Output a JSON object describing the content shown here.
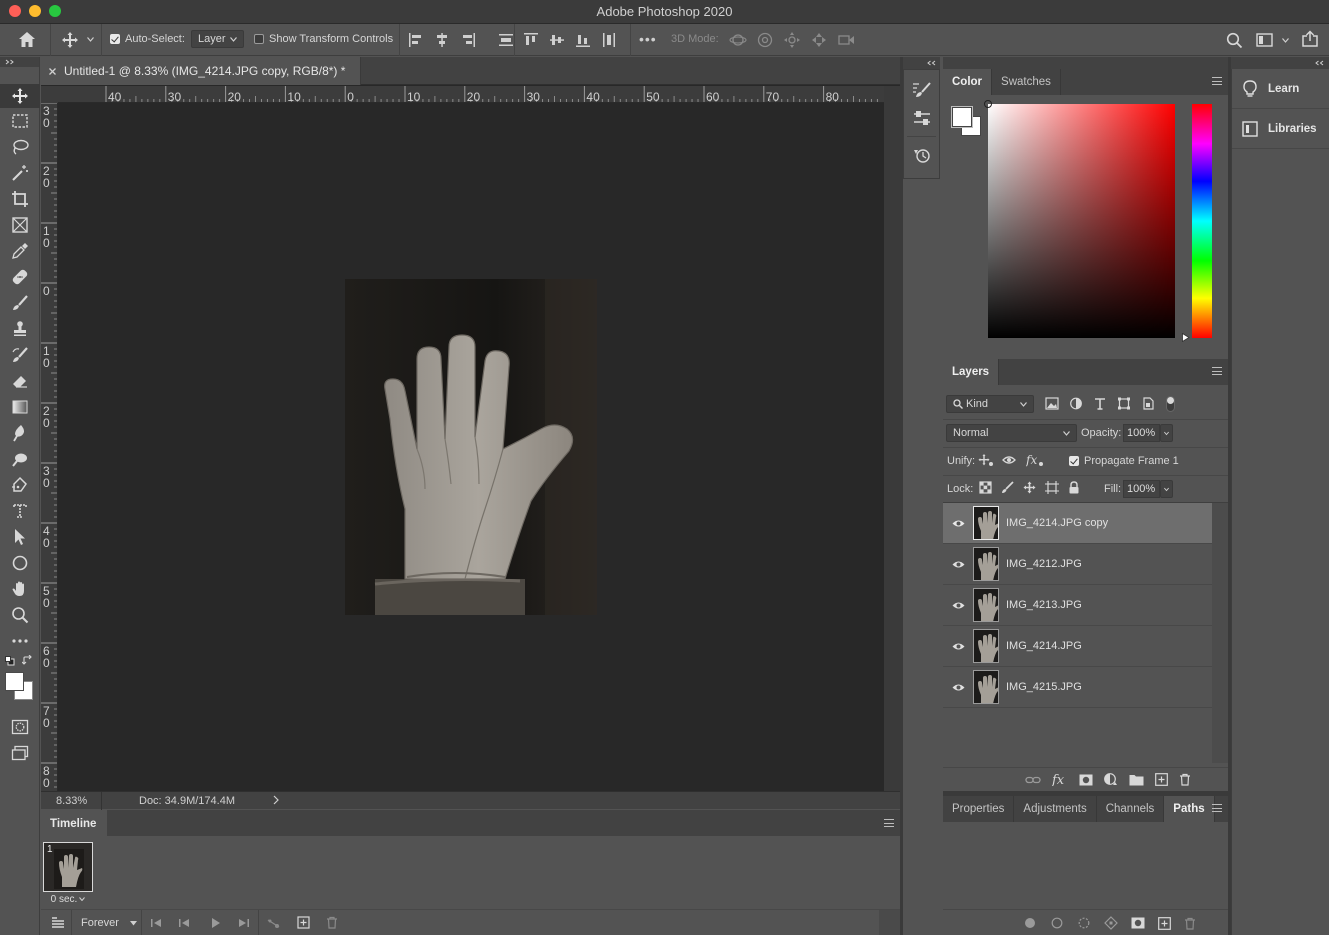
{
  "app": {
    "title": "Adobe Photoshop 2020"
  },
  "options_bar": {
    "auto_select_label": "Auto-Select:",
    "auto_select_value": "Layer",
    "show_transform_label": "Show Transform Controls",
    "more_label": "•••",
    "mode_3d_label": "3D Mode:"
  },
  "document": {
    "tab_title": "Untitled-1 @ 8.33% (IMG_4214.JPG copy, RGB/8*) *",
    "zoom": "8.33%",
    "doc_info": "Doc: 34.9M/174.4M"
  },
  "ruler": {
    "h_labels": [
      "40",
      "30",
      "20",
      "10",
      "0",
      "10",
      "20",
      "30",
      "40",
      "50",
      "60",
      "70",
      "80"
    ],
    "v_labels": [
      "3\n0",
      "2\n0",
      "1\n0",
      "0",
      "1\n0",
      "2\n0",
      "3\n0",
      "4\n0",
      "5\n0",
      "6\n0",
      "7\n0",
      "8\n0"
    ]
  },
  "timeline": {
    "title": "Timeline",
    "frame_number": "1",
    "frame_delay": "0 sec.",
    "loop_value": "Forever"
  },
  "color_panel": {
    "tabs": [
      "Color",
      "Swatches"
    ],
    "active_tab": "Color"
  },
  "layers_panel": {
    "title": "Layers",
    "filter_kind": "Kind",
    "blend_mode": "Normal",
    "opacity_label": "Opacity:",
    "opacity_value": "100%",
    "unify_label": "Unify:",
    "propagate_label": "Propagate Frame 1",
    "lock_label": "Lock:",
    "fill_label": "Fill:",
    "fill_value": "100%",
    "layers": [
      {
        "name": "IMG_4214.JPG copy",
        "selected": true
      },
      {
        "name": "IMG_4212.JPG",
        "selected": false
      },
      {
        "name": "IMG_4213.JPG",
        "selected": false
      },
      {
        "name": "IMG_4214.JPG",
        "selected": false
      },
      {
        "name": "IMG_4215.JPG",
        "selected": false
      }
    ]
  },
  "bottom_panel": {
    "tabs": [
      "Properties",
      "Adjustments",
      "Channels",
      "Paths"
    ],
    "active_tab": "Paths"
  },
  "right_panel": {
    "items": [
      "Learn",
      "Libraries"
    ]
  },
  "colors": {
    "accent_selected_row": "#6e6e6e",
    "panel_bg": "#535353",
    "canvas_bg": "#282828"
  }
}
